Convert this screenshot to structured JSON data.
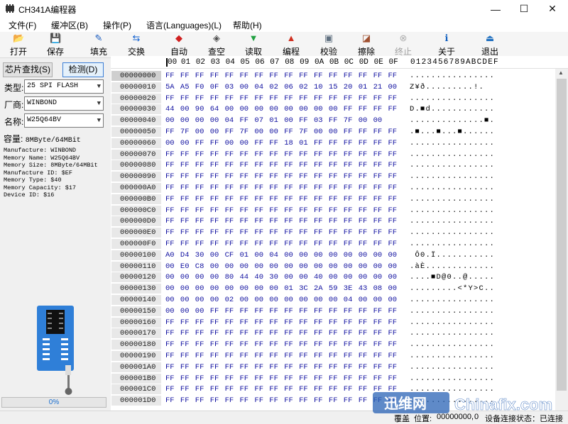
{
  "window": {
    "title": "CH341A编程器",
    "min_glyph": "—",
    "max_glyph": "☐",
    "close_glyph": "✕"
  },
  "menu": [
    "文件(F)",
    "缓冲区(B)",
    "操作(P)",
    "语言(Languages)(L)",
    "帮助(H)"
  ],
  "toolbar": [
    {
      "label": "打开",
      "icon": "open-folder-icon",
      "glyph": "📂",
      "enabled": true
    },
    {
      "label": "保存",
      "icon": "save-disk-icon",
      "glyph": "💾",
      "enabled": true
    },
    {
      "label": "填充",
      "icon": "fill-icon",
      "glyph": "✎",
      "enabled": true
    },
    {
      "label": "交换",
      "icon": "swap-arrows-icon",
      "glyph": "⇆",
      "enabled": true
    },
    {
      "label": "自动",
      "icon": "auto-icon",
      "glyph": "◆",
      "enabled": true
    },
    {
      "label": "查空",
      "icon": "blank-check-icon",
      "glyph": "◈",
      "enabled": true
    },
    {
      "label": "读取",
      "icon": "read-icon",
      "glyph": "▼",
      "enabled": true
    },
    {
      "label": "编程",
      "icon": "program-icon",
      "glyph": "▲",
      "enabled": true
    },
    {
      "label": "校验",
      "icon": "verify-icon",
      "glyph": "▣",
      "enabled": true
    },
    {
      "label": "擦除",
      "icon": "erase-icon",
      "glyph": "◪",
      "enabled": true
    },
    {
      "label": "终止",
      "icon": "stop-icon",
      "glyph": "⊗",
      "enabled": false
    },
    {
      "label": "关于",
      "icon": "about-info-icon",
      "glyph": "ℹ",
      "enabled": true
    },
    {
      "label": "退出",
      "icon": "exit-icon",
      "glyph": "⏏",
      "enabled": true
    }
  ],
  "left_panel": {
    "find_button": "芯片查找(S)",
    "detect_button": "检测(D)",
    "type_label": "类型:",
    "type_value": "25 SPI FLASH",
    "vendor_label": "厂商:",
    "vendor_value": "WINBOND",
    "name_label": "名称:",
    "name_value": "W25Q64BV",
    "capacity_label": "容量:",
    "capacity_value": "8MByte/64MBit",
    "info": [
      "Manufacture: WINBOND",
      "Memory Name: W25Q64BV",
      "Memory Size: 8MByte/64MBit",
      "Manufacture ID: $EF",
      "Memory Type: $40",
      "Memory Capacity: $17",
      "Device ID: $16"
    ],
    "progress": "0%"
  },
  "hex": {
    "header_cols": [
      "00",
      "01",
      "02",
      "03",
      "04",
      "05",
      "06",
      "07",
      "08",
      "09",
      "0A",
      "0B",
      "0C",
      "0D",
      "0E",
      "0F"
    ],
    "ascii_header": "0123456789ABCDEF",
    "rows": [
      {
        "addr": "00000000",
        "bytes": [
          "FF",
          "FF",
          "FF",
          "FF",
          "FF",
          "FF",
          "FF",
          "FF",
          "FF",
          "FF",
          "FF",
          "FF",
          "FF",
          "FF",
          "FF",
          "FF"
        ],
        "ascii": "................"
      },
      {
        "addr": "00000010",
        "bytes": [
          "5A",
          "A5",
          "F0",
          "0F",
          "03",
          "00",
          "04",
          "02",
          "06",
          "02",
          "10",
          "15",
          "20",
          "01",
          "21",
          "00"
        ],
        "ascii": "Z¥ð.........!."
      },
      {
        "addr": "00000020",
        "bytes": [
          "FF",
          "FF",
          "FF",
          "FF",
          "FF",
          "FF",
          "FF",
          "FF",
          "FF",
          "FF",
          "FF",
          "FF",
          "FF",
          "FF",
          "FF",
          "FF"
        ],
        "ascii": "................"
      },
      {
        "addr": "00000030",
        "bytes": [
          "44",
          "00",
          "90",
          "64",
          "00",
          "00",
          "00",
          "00",
          "00",
          "00",
          "00",
          "00",
          "FF",
          "FF",
          "FF",
          "FF"
        ],
        "ascii": "D.■d............"
      },
      {
        "addr": "00000040",
        "bytes": [
          "00",
          "00",
          "00",
          "00",
          "04",
          "FF",
          "07",
          "01",
          "00",
          "FF",
          "03",
          "FF",
          "7F",
          "00",
          "00"
        ],
        "ascii": "..............■."
      },
      {
        "addr": "00000050",
        "bytes": [
          "FF",
          "7F",
          "00",
          "00",
          "FF",
          "7F",
          "00",
          "00",
          "FF",
          "7F",
          "00",
          "00",
          "FF",
          "FF",
          "FF",
          "FF"
        ],
        "ascii": ".■...■...■......"
      },
      {
        "addr": "00000060",
        "bytes": [
          "00",
          "00",
          "FF",
          "FF",
          "00",
          "00",
          "FF",
          "FF",
          "18",
          "01",
          "FF",
          "FF",
          "FF",
          "FF",
          "FF",
          "FF"
        ],
        "ascii": "................"
      },
      {
        "addr": "00000070",
        "bytes": [
          "FF",
          "FF",
          "FF",
          "FF",
          "FF",
          "FF",
          "FF",
          "FF",
          "FF",
          "FF",
          "FF",
          "FF",
          "FF",
          "FF",
          "FF",
          "FF"
        ],
        "ascii": "................"
      },
      {
        "addr": "00000080",
        "bytes": [
          "FF",
          "FF",
          "FF",
          "FF",
          "FF",
          "FF",
          "FF",
          "FF",
          "FF",
          "FF",
          "FF",
          "FF",
          "FF",
          "FF",
          "FF",
          "FF"
        ],
        "ascii": "................"
      },
      {
        "addr": "00000090",
        "bytes": [
          "FF",
          "FF",
          "FF",
          "FF",
          "FF",
          "FF",
          "FF",
          "FF",
          "FF",
          "FF",
          "FF",
          "FF",
          "FF",
          "FF",
          "FF",
          "FF"
        ],
        "ascii": "................"
      },
      {
        "addr": "000000A0",
        "bytes": [
          "FF",
          "FF",
          "FF",
          "FF",
          "FF",
          "FF",
          "FF",
          "FF",
          "FF",
          "FF",
          "FF",
          "FF",
          "FF",
          "FF",
          "FF",
          "FF"
        ],
        "ascii": "................"
      },
      {
        "addr": "000000B0",
        "bytes": [
          "FF",
          "FF",
          "FF",
          "FF",
          "FF",
          "FF",
          "FF",
          "FF",
          "FF",
          "FF",
          "FF",
          "FF",
          "FF",
          "FF",
          "FF",
          "FF"
        ],
        "ascii": "................"
      },
      {
        "addr": "000000C0",
        "bytes": [
          "FF",
          "FF",
          "FF",
          "FF",
          "FF",
          "FF",
          "FF",
          "FF",
          "FF",
          "FF",
          "FF",
          "FF",
          "FF",
          "FF",
          "FF",
          "FF"
        ],
        "ascii": "................"
      },
      {
        "addr": "000000D0",
        "bytes": [
          "FF",
          "FF",
          "FF",
          "FF",
          "FF",
          "FF",
          "FF",
          "FF",
          "FF",
          "FF",
          "FF",
          "FF",
          "FF",
          "FF",
          "FF",
          "FF"
        ],
        "ascii": "................"
      },
      {
        "addr": "000000E0",
        "bytes": [
          "FF",
          "FF",
          "FF",
          "FF",
          "FF",
          "FF",
          "FF",
          "FF",
          "FF",
          "FF",
          "FF",
          "FF",
          "FF",
          "FF",
          "FF",
          "FF"
        ],
        "ascii": "................"
      },
      {
        "addr": "000000F0",
        "bytes": [
          "FF",
          "FF",
          "FF",
          "FF",
          "FF",
          "FF",
          "FF",
          "FF",
          "FF",
          "FF",
          "FF",
          "FF",
          "FF",
          "FF",
          "FF",
          "FF"
        ],
        "ascii": "................"
      },
      {
        "addr": "00000100",
        "bytes": [
          "A0",
          "D4",
          "30",
          "00",
          "CF",
          "01",
          "00",
          "04",
          "00",
          "00",
          "00",
          "00",
          "00",
          "00",
          "00",
          "00"
        ],
        "ascii": " Ô0.Ï..........."
      },
      {
        "addr": "00000110",
        "bytes": [
          "00",
          "E0",
          "C8",
          "00",
          "00",
          "00",
          "00",
          "00",
          "00",
          "00",
          "00",
          "00",
          "00",
          "00",
          "00",
          "00"
        ],
        "ascii": ".àÈ............."
      },
      {
        "addr": "00000120",
        "bytes": [
          "00",
          "00",
          "00",
          "00",
          "80",
          "44",
          "40",
          "30",
          "00",
          "00",
          "40",
          "00",
          "00",
          "00",
          "00",
          "00"
        ],
        "ascii": "....■D@0..@....."
      },
      {
        "addr": "00000130",
        "bytes": [
          "00",
          "00",
          "00",
          "00",
          "00",
          "00",
          "00",
          "00",
          "01",
          "3C",
          "2A",
          "59",
          "3E",
          "43",
          "08",
          "00"
        ],
        "ascii": ".........<*Y>C.."
      },
      {
        "addr": "00000140",
        "bytes": [
          "00",
          "00",
          "00",
          "00",
          "02",
          "00",
          "00",
          "00",
          "00",
          "00",
          "00",
          "00",
          "04",
          "00",
          "00",
          "00"
        ],
        "ascii": "................"
      },
      {
        "addr": "00000150",
        "bytes": [
          "00",
          "00",
          "00",
          "FF",
          "FF",
          "FF",
          "FF",
          "FF",
          "FF",
          "FF",
          "FF",
          "FF",
          "FF",
          "FF",
          "FF",
          "FF"
        ],
        "ascii": "................"
      },
      {
        "addr": "00000160",
        "bytes": [
          "FF",
          "FF",
          "FF",
          "FF",
          "FF",
          "FF",
          "FF",
          "FF",
          "FF",
          "FF",
          "FF",
          "FF",
          "FF",
          "FF",
          "FF",
          "FF"
        ],
        "ascii": "................"
      },
      {
        "addr": "00000170",
        "bytes": [
          "FF",
          "FF",
          "FF",
          "FF",
          "FF",
          "FF",
          "FF",
          "FF",
          "FF",
          "FF",
          "FF",
          "FF",
          "FF",
          "FF",
          "FF",
          "FF"
        ],
        "ascii": "................"
      },
      {
        "addr": "00000180",
        "bytes": [
          "FF",
          "FF",
          "FF",
          "FF",
          "FF",
          "FF",
          "FF",
          "FF",
          "FF",
          "FF",
          "FF",
          "FF",
          "FF",
          "FF",
          "FF",
          "FF"
        ],
        "ascii": "................"
      },
      {
        "addr": "00000190",
        "bytes": [
          "FF",
          "FF",
          "FF",
          "FF",
          "FF",
          "FF",
          "FF",
          "FF",
          "FF",
          "FF",
          "FF",
          "FF",
          "FF",
          "FF",
          "FF",
          "FF"
        ],
        "ascii": "................"
      },
      {
        "addr": "000001A0",
        "bytes": [
          "FF",
          "FF",
          "FF",
          "FF",
          "FF",
          "FF",
          "FF",
          "FF",
          "FF",
          "FF",
          "FF",
          "FF",
          "FF",
          "FF",
          "FF",
          "FF"
        ],
        "ascii": "................"
      },
      {
        "addr": "000001B0",
        "bytes": [
          "FF",
          "FF",
          "FF",
          "FF",
          "FF",
          "FF",
          "FF",
          "FF",
          "FF",
          "FF",
          "FF",
          "FF",
          "FF",
          "FF",
          "FF",
          "FF"
        ],
        "ascii": "................"
      },
      {
        "addr": "000001C0",
        "bytes": [
          "FF",
          "FF",
          "FF",
          "FF",
          "FF",
          "FF",
          "FF",
          "FF",
          "FF",
          "FF",
          "FF",
          "FF",
          "FF",
          "FF",
          "FF",
          "FF"
        ],
        "ascii": "................"
      },
      {
        "addr": "000001D0",
        "bytes": [
          "FF",
          "FF",
          "FF",
          "FF",
          "FF",
          "FF",
          "FF",
          "FF",
          "FF",
          "FF",
          "FF",
          "FF",
          "FF",
          "FF",
          "FF",
          "FF"
        ],
        "ascii": "................"
      }
    ]
  },
  "status": {
    "mode_label": "覆盖",
    "position_label": "位置:",
    "position_value": "00000000,",
    "offset_value": "0",
    "device_status": "设备连接状态：已连接"
  },
  "watermark": {
    "cn": "迅维网",
    "en": "Chinafix.com"
  },
  "colors": {
    "hex_byte": "#1010a0",
    "address_bg": "#e8e8e8",
    "progress_text": "#1a6fd0",
    "chip_board": "#2f7fd8"
  }
}
